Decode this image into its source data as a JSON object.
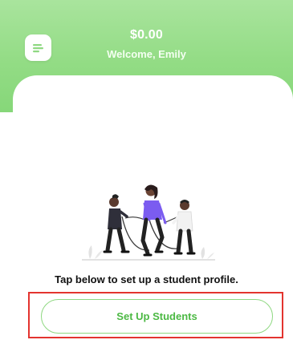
{
  "header": {
    "balance": "$0.00",
    "welcome": "Welcome, Emily",
    "menu_icon": "menu-lines-icon"
  },
  "main": {
    "illustration": "children-jump-rope-illustration",
    "prompt": "Tap below to set up a student profile.",
    "setup_button_label": "Set Up Students"
  },
  "colors": {
    "header_green": "#93dc85",
    "button_text_green": "#4cb944",
    "button_border_green": "#8fd882",
    "highlight_red": "#e3342f"
  }
}
